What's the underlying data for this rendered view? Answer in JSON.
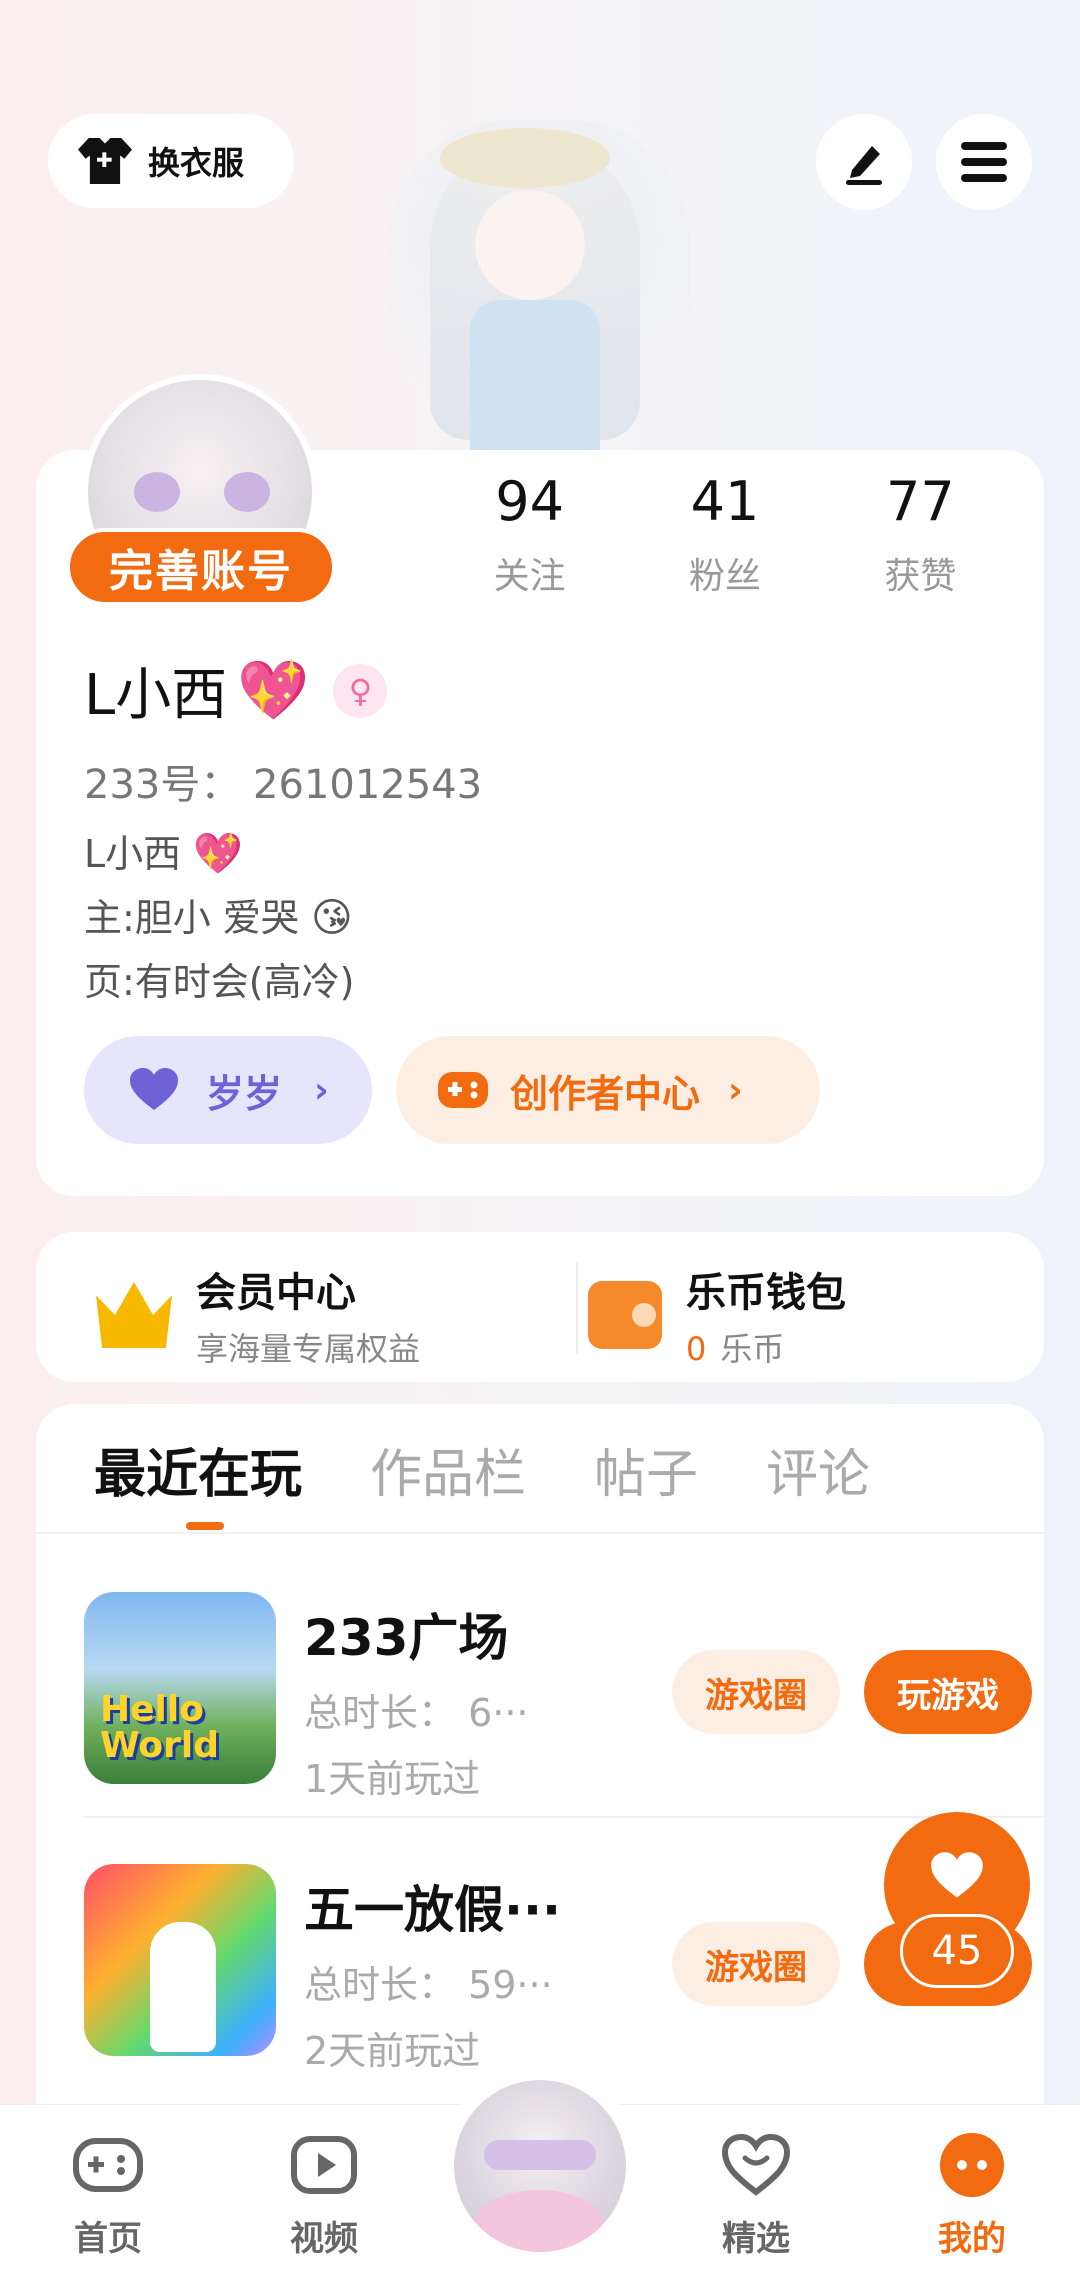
{
  "header": {
    "outfit_label": "换衣服",
    "edit_icon": "pen-icon",
    "menu_icon": "menu-icon"
  },
  "profile": {
    "badge": "完善账号",
    "stats": [
      {
        "value": "94",
        "label": "关注"
      },
      {
        "value": "41",
        "label": "粉丝"
      },
      {
        "value": "77",
        "label": "获赞"
      }
    ],
    "name": "L小西",
    "name_emoji": "💖",
    "gender_symbol": "♀",
    "uid": "233号： 261012543",
    "bio_lines": [
      {
        "text": "L小西",
        "emoji": "💖"
      },
      {
        "text": "主:胆小 爱哭",
        "emoji": "😘"
      },
      {
        "text": "页:有时会(高冷)",
        "emoji": ""
      }
    ],
    "chips": {
      "suisui": "岁岁",
      "creator": "创作者中心",
      "chevron": "›"
    }
  },
  "member": {
    "vip_title": "会员中心",
    "vip_sub": "享海量专属权益",
    "wallet_title": "乐币钱包",
    "wallet_balance": "0",
    "wallet_unit": "乐币"
  },
  "tabs": [
    "最近在玩",
    "作品栏",
    "帖子",
    "评论"
  ],
  "games": [
    {
      "title": "233广场",
      "duration": "总时长： 6···",
      "last_played": "1天前玩过",
      "thumb_text": "Hello World",
      "btn_circle": "游戏圈",
      "btn_play": "玩游戏"
    },
    {
      "title": "五一放假···",
      "duration": "总时长： 59···",
      "last_played": "2天前玩过",
      "btn_circle": "游戏圈",
      "btn_play": "玩"
    }
  ],
  "like": {
    "icon": "heart-icon",
    "count": "45"
  },
  "nav": {
    "home": "首页",
    "video": "视频",
    "featured": "精选",
    "me": "我的"
  },
  "colors": {
    "accent": "#f26b11",
    "purple": "#6d62d6"
  }
}
